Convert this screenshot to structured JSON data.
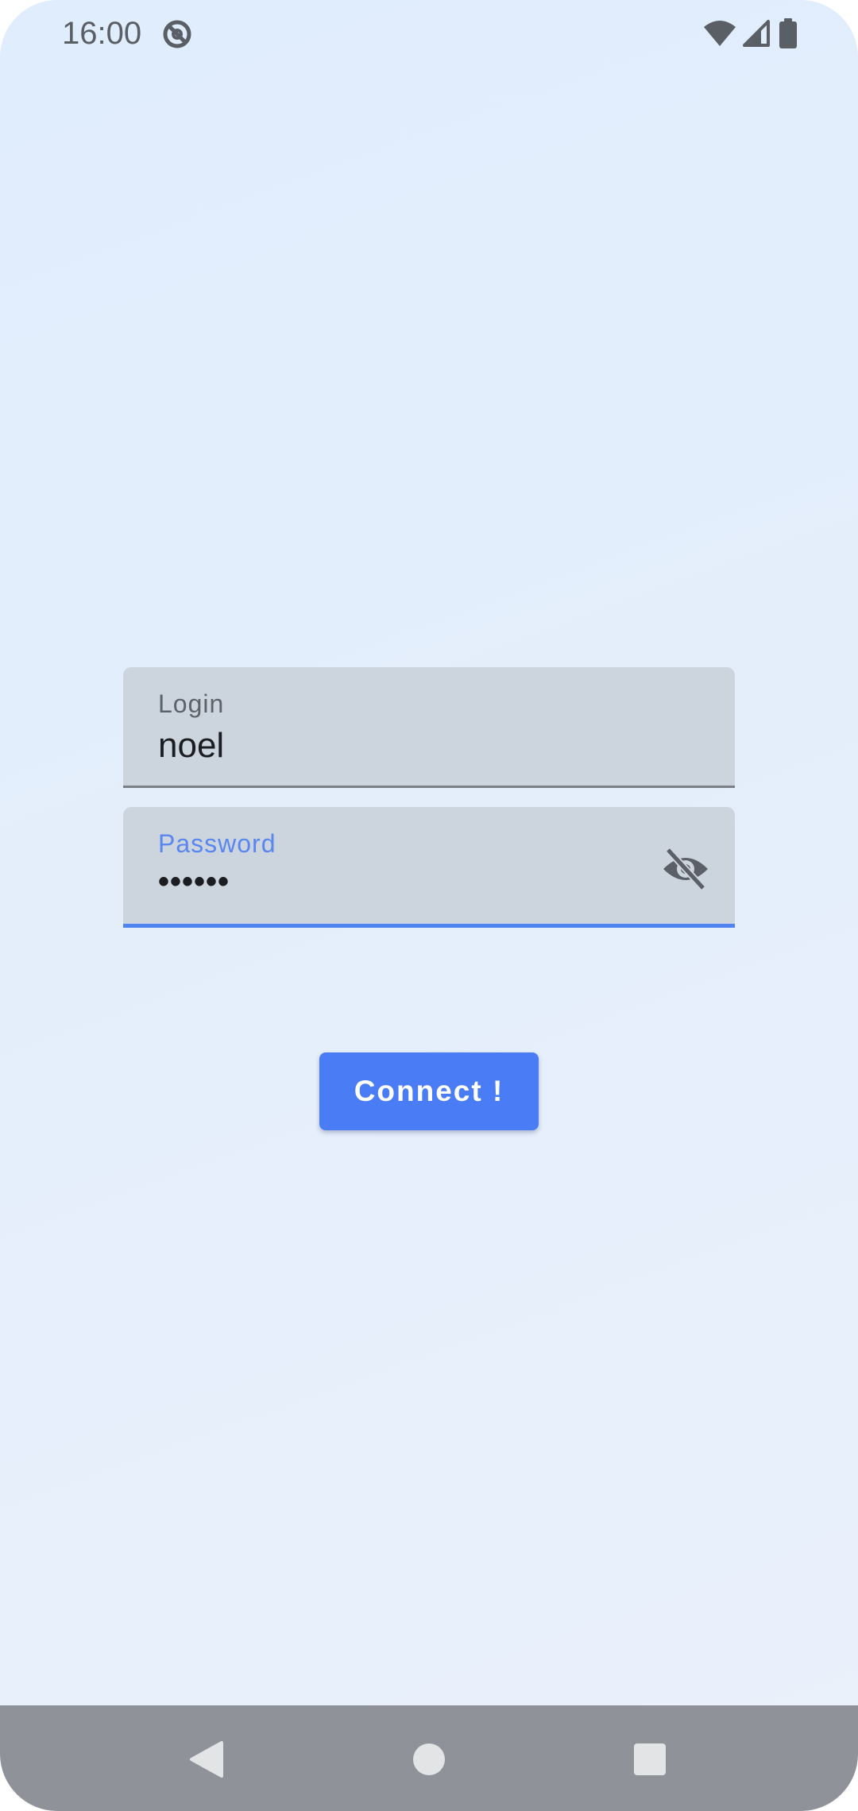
{
  "status_bar": {
    "time": "16:00",
    "icons": [
      "app-notification-icon",
      "wifi-icon",
      "cellular-signal-icon",
      "battery-icon"
    ]
  },
  "login_form": {
    "login_label": "Login",
    "login_value": "noel",
    "password_label": "Password",
    "password_value": "••••••",
    "visibility_icon": "visibility-off-icon",
    "connect_label": "Connect !"
  },
  "nav_bar": {
    "icons": [
      "back-icon",
      "home-icon",
      "recents-icon"
    ]
  },
  "colors": {
    "accent": "#4a7cf5",
    "field_background": "#ccd4de",
    "focused_underline": "#4f83f1",
    "nav_bar": "#8f9399"
  }
}
